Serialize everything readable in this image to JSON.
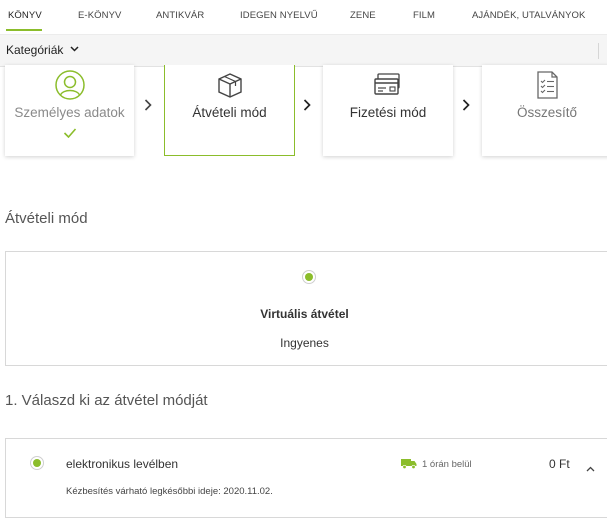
{
  "nav": {
    "items": [
      "KÖNYV",
      "E-KÖNYV",
      "ANTIKVÁR",
      "IDEGEN NYELVŰ",
      "ZENE",
      "FILM",
      "AJÁNDÉK, UTALVÁNYOK"
    ],
    "active_index": 0
  },
  "categories": {
    "label": "Kategóriák"
  },
  "steps": [
    {
      "label": "Személyes adatok",
      "state": "done",
      "icon": "user-circle-icon"
    },
    {
      "label": "Átvételi mód",
      "state": "active",
      "icon": "package-box-icon"
    },
    {
      "label": "Fizetési mód",
      "state": "pending",
      "icon": "credit-card-icon"
    },
    {
      "label": "Összesítő",
      "state": "pending",
      "icon": "checklist-icon"
    }
  ],
  "delivery_section": {
    "title": "Átvételi mód",
    "selected_method": {
      "name": "Virtuális átvétel",
      "price": "Ingyenes"
    }
  },
  "options_section": {
    "title": "1. Válaszd ki az átvétel módját",
    "options": [
      {
        "name": "elektronikus levélben",
        "time": "1 órán belül",
        "price": "0 Ft",
        "note": "Kézbesítés várható legkésőbbi ideje: 2020.11.02."
      }
    ]
  },
  "colors": {
    "accent": "#8bbd2b",
    "border": "#d8d8d8"
  }
}
